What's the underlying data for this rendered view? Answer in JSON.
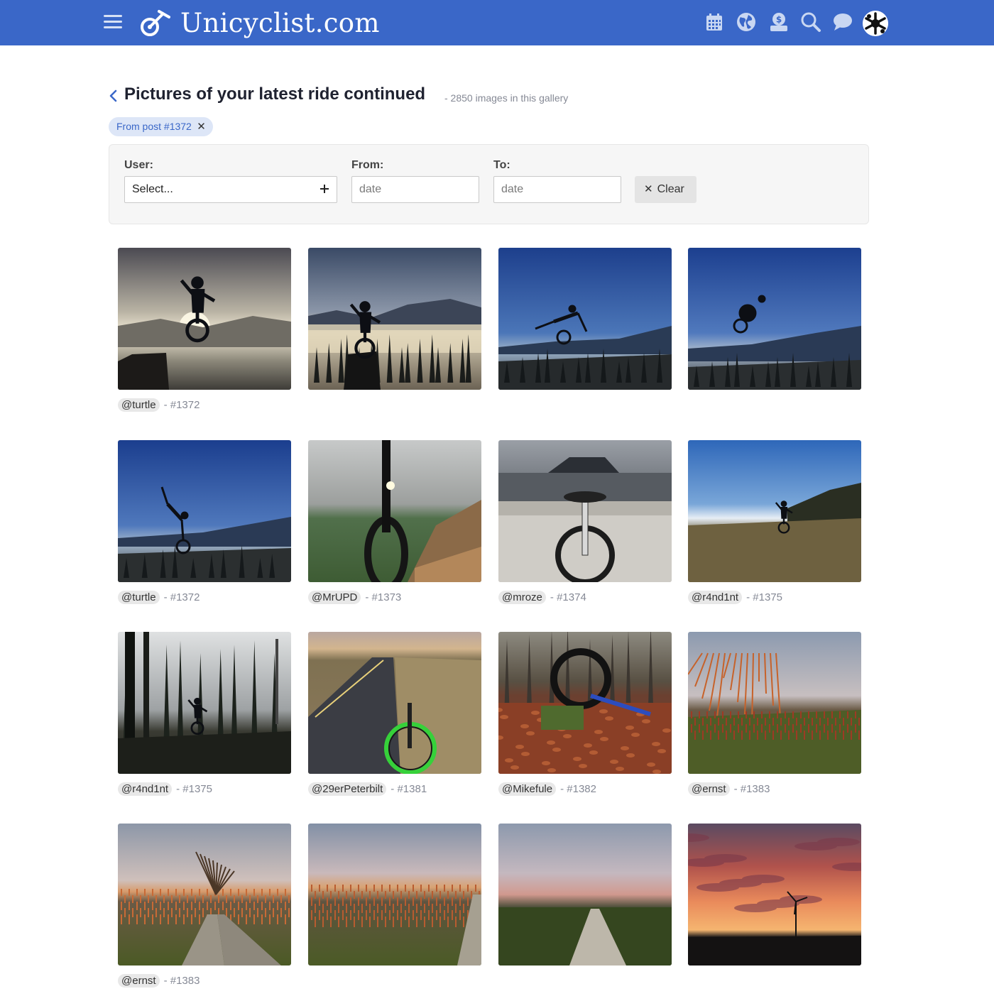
{
  "header": {
    "brand": "Unicyclist.com",
    "icons": [
      "menu-icon",
      "unicycle-logo-icon",
      "calendar-icon",
      "globe-icon",
      "market-icon",
      "search-icon",
      "chat-icon",
      "avatar"
    ]
  },
  "page": {
    "title": "Pictures of your latest ride continued",
    "count": "- 2850 images in this gallery",
    "chip": "From post #1372"
  },
  "filters": {
    "user_label": "User:",
    "user_value": "Select...",
    "from_label": "From:",
    "from_placeholder": "date",
    "to_label": "To:",
    "to_placeholder": "date",
    "clear_label": "Clear"
  },
  "gallery": [
    {
      "user": "@turtle",
      "post": "- #1372",
      "scene": "sun-jump"
    },
    {
      "user": "",
      "post": "",
      "scene": "mountain-rock"
    },
    {
      "user": "",
      "post": "",
      "scene": "blue-jump"
    },
    {
      "user": "",
      "post": "",
      "scene": "blue-tuck"
    },
    {
      "user": "@turtle",
      "post": "- #1372",
      "scene": "handstand"
    },
    {
      "user": "@MrUPD",
      "post": "- #1373",
      "scene": "fog-bench"
    },
    {
      "user": "@mroze",
      "post": "- #1374",
      "scene": "lake-pier"
    },
    {
      "user": "@r4nd1nt",
      "post": "- #1375",
      "scene": "meadow-rider"
    },
    {
      "user": "@r4nd1nt",
      "post": "- #1375",
      "scene": "forest-fog"
    },
    {
      "user": "@29erPeterbilt",
      "post": "- #1381",
      "scene": "road-green"
    },
    {
      "user": "@Mikefule",
      "post": "- #1382",
      "scene": "leaves"
    },
    {
      "user": "@ernst",
      "post": "- #1383",
      "scene": "vineyard-tree"
    },
    {
      "user": "@ernst",
      "post": "- #1383",
      "scene": "vineyard-path"
    },
    {
      "user": "",
      "post": "",
      "scene": "vineyard-rows"
    },
    {
      "user": "",
      "post": "",
      "scene": "dusk-path"
    },
    {
      "user": "",
      "post": "",
      "scene": "red-sky-turbine"
    }
  ]
}
